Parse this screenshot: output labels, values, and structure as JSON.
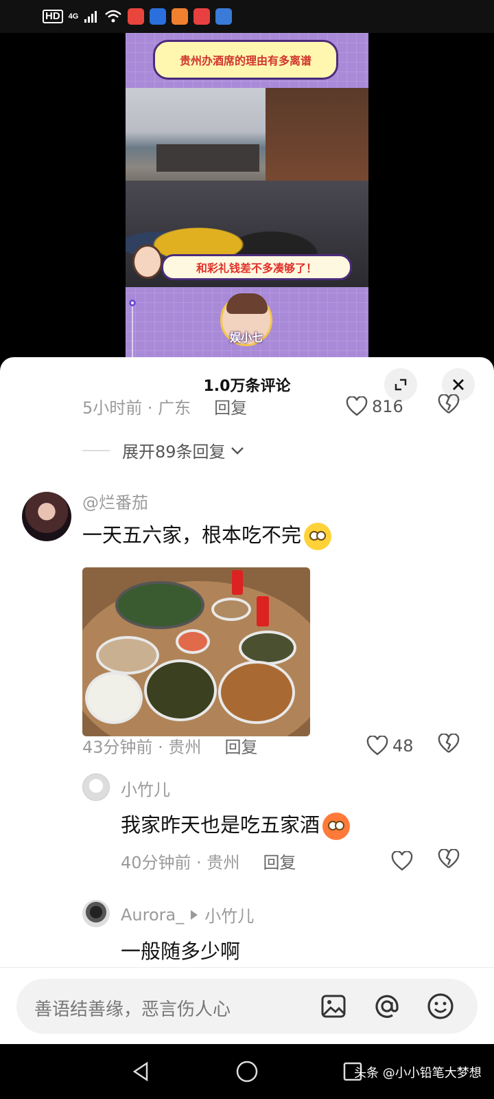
{
  "status_bar": {
    "hd": "HD",
    "network": "4G",
    "app_icon_colors": [
      "#e8453c",
      "#2a6fdc",
      "#f08030",
      "#e84040",
      "#3a7ad8"
    ]
  },
  "video": {
    "title": "贵州办酒席的理由有多离谱",
    "caption": "和彩礼钱差不多凑够了！",
    "author_badge": "娱小七"
  },
  "comments_panel": {
    "title": "1.0万条评论",
    "prev_comment": {
      "time_location": "5小时前 · 广东",
      "reply": "回复",
      "likes": "816"
    },
    "expand_replies": "展开89条回复",
    "comment": {
      "username": "@烂番茄",
      "text": "一天五六家，根本吃不完",
      "time_location": "43分钟前 · 贵州",
      "reply": "回复",
      "likes": "48"
    },
    "reply1": {
      "username": "小竹儿",
      "text": "我家昨天也是吃五家酒",
      "time_location": "40分钟前 · 贵州",
      "reply": "回复"
    },
    "reply2": {
      "username": "Aurora_",
      "reply_to": "小竹儿",
      "text": "一般随多少啊"
    }
  },
  "input_bar": {
    "placeholder": "善语结善缘，恶言伤人心",
    "icons": [
      "image-icon",
      "at-icon",
      "emoji-icon"
    ]
  },
  "nav_bar": {
    "watermark": "头条 @小小铅笔大梦想"
  }
}
